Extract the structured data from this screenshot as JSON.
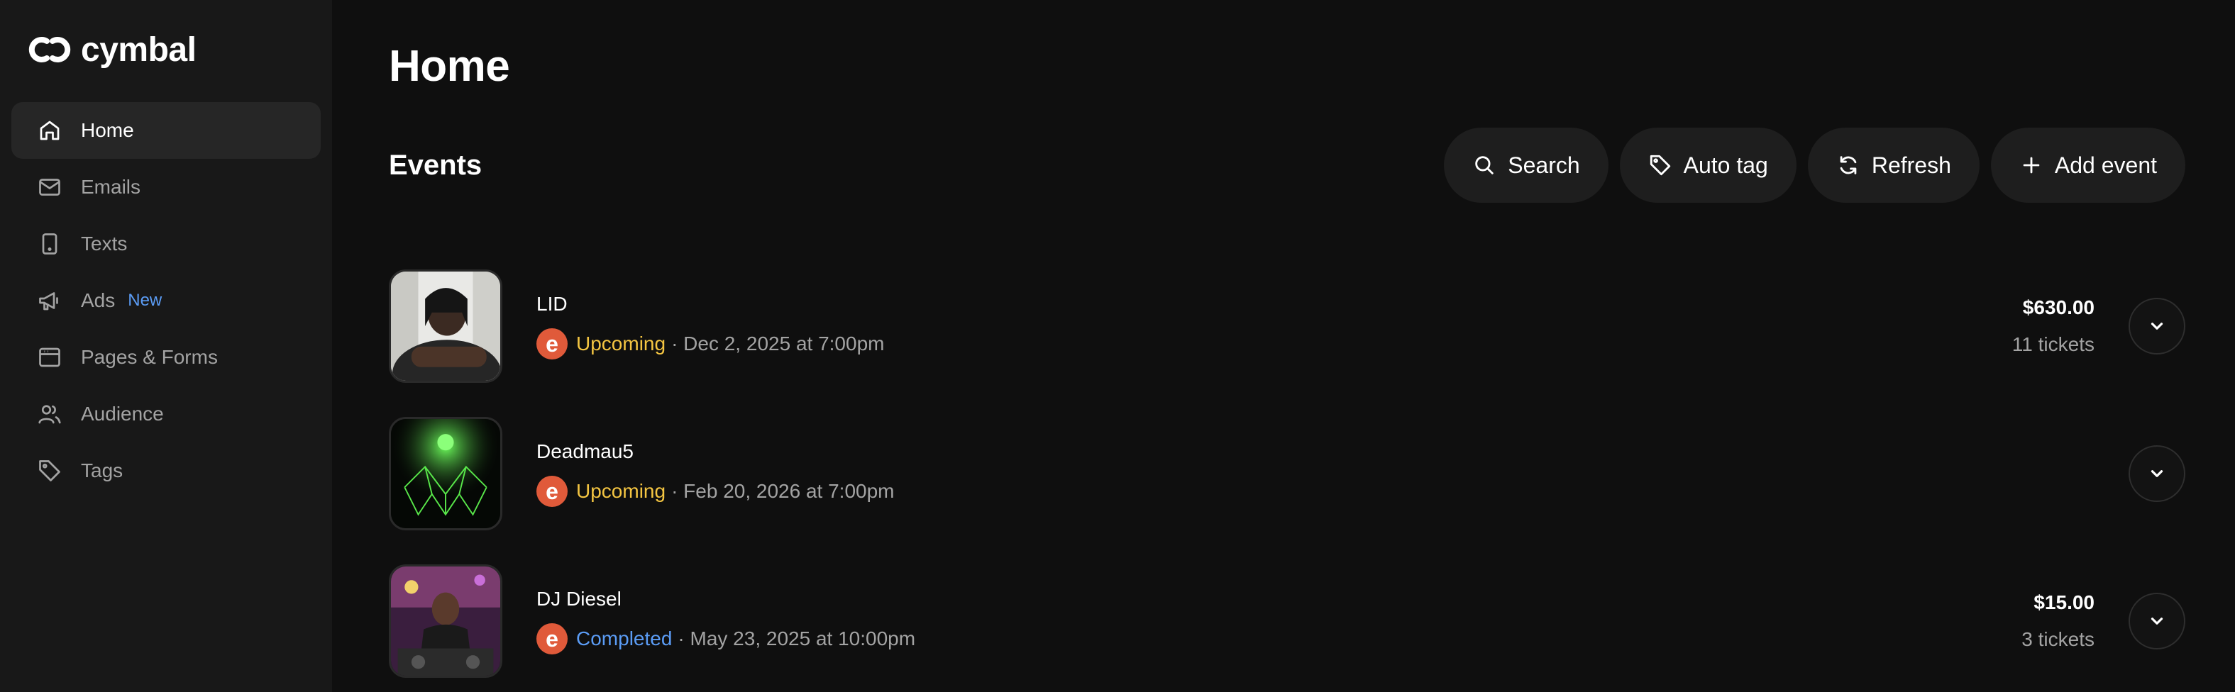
{
  "brand": {
    "name": "cymbal"
  },
  "sidebar": {
    "items": [
      {
        "label": "Home",
        "icon": "home-icon",
        "active": true
      },
      {
        "label": "Emails",
        "icon": "mail-icon"
      },
      {
        "label": "Texts",
        "icon": "phone-icon"
      },
      {
        "label": "Ads",
        "icon": "megaphone-icon",
        "badge": "New"
      },
      {
        "label": "Pages & Forms",
        "icon": "browser-icon"
      },
      {
        "label": "Audience",
        "icon": "users-icon"
      },
      {
        "label": "Tags",
        "icon": "tag-icon"
      }
    ]
  },
  "main": {
    "title": "Home",
    "section_title": "Events",
    "toolbar": {
      "search_label": "Search",
      "autotag_label": "Auto tag",
      "refresh_label": "Refresh",
      "add_label": "Add event"
    },
    "events": [
      {
        "name": "LID",
        "status": "Upcoming",
        "date": "· Dec 2, 2025 at 7:00pm",
        "amount": "$630.00",
        "tickets": "11 tickets"
      },
      {
        "name": "Deadmau5",
        "status": "Upcoming",
        "date": "· Feb 20, 2026 at 7:00pm",
        "amount": "",
        "tickets": ""
      },
      {
        "name": "DJ Diesel",
        "status": "Completed",
        "date": "· May 23, 2025 at 10:00pm",
        "amount": "$15.00",
        "tickets": "3 tickets"
      }
    ]
  },
  "colors": {
    "background": "#0f0f0f",
    "sidebar": "#181818",
    "upcoming": "#f4c542",
    "completed": "#5b9cf5",
    "eventbrite": "#e05a3a",
    "new_badge": "#5b9cf5"
  }
}
